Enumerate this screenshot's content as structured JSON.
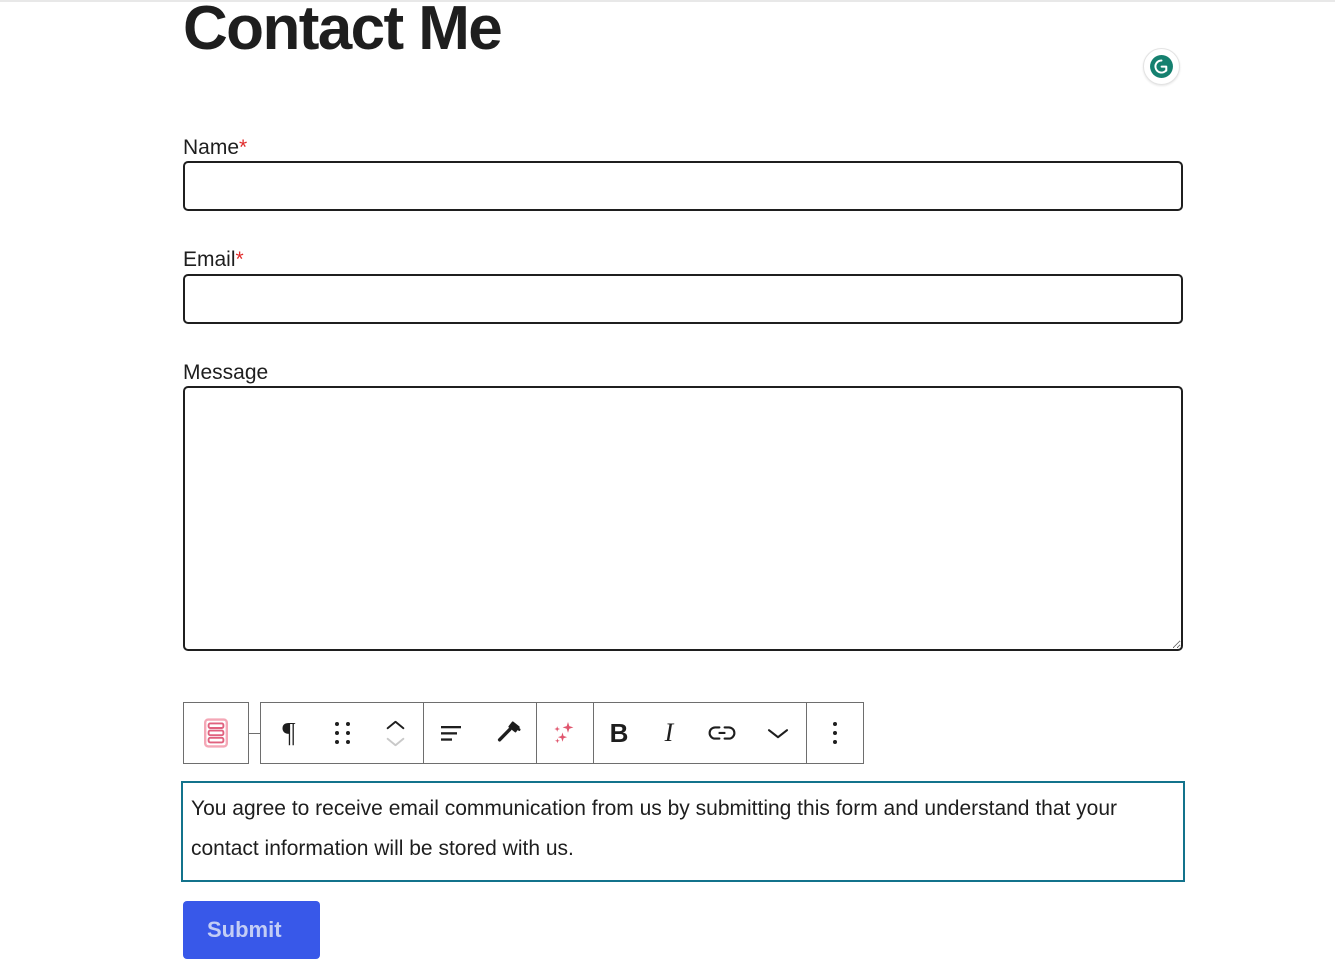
{
  "page": {
    "title": "Contact Me",
    "background": "#ffffff"
  },
  "browser_extension": {
    "name": "grammarly-badge",
    "letter": "G",
    "color": "#15806f"
  },
  "form": {
    "fields": [
      {
        "label": "Name",
        "required_marker": "*",
        "required": true,
        "value": "",
        "placeholder": "",
        "type": "text"
      },
      {
        "label": "Email",
        "required_marker": "*",
        "required": true,
        "value": "",
        "placeholder": "",
        "type": "email"
      },
      {
        "label": "Message",
        "required_marker": "",
        "required": false,
        "value": "",
        "placeholder": "",
        "type": "textarea"
      }
    ],
    "consent_text": "You agree to receive email communication from us by submitting this form and understand that your contact information will be stored with us.",
    "consent_border_color": "#13738c",
    "submit": {
      "label": "Submit",
      "background": "#3858e9",
      "text_color": "#c3cdf5"
    }
  },
  "block_toolbar": {
    "block_type_icon": "form-block-icon",
    "block_type_color": "#e8738f",
    "groups": [
      {
        "buttons": [
          {
            "name": "paragraph-icon",
            "glyph": "¶",
            "label": "Paragraph",
            "state": "enabled"
          },
          {
            "name": "drag-handle-icon",
            "glyph": "",
            "label": "Drag",
            "state": "enabled"
          },
          {
            "name": "move-up-down-icon",
            "glyph": "",
            "label": "Move up or down",
            "state": "partial"
          }
        ]
      },
      {
        "buttons": [
          {
            "name": "align-left-icon",
            "glyph": "",
            "label": "Align text",
            "state": "enabled"
          },
          {
            "name": "style-brush-icon",
            "glyph": "",
            "label": "Styles",
            "state": "enabled"
          }
        ]
      },
      {
        "buttons": [
          {
            "name": "ai-sparkles-icon",
            "glyph": "",
            "label": "AI assistant",
            "state": "enabled",
            "color": "#e0566e"
          }
        ]
      },
      {
        "buttons": [
          {
            "name": "bold-icon",
            "glyph": "B",
            "label": "Bold",
            "state": "enabled"
          },
          {
            "name": "italic-icon",
            "glyph": "I",
            "label": "Italic",
            "state": "enabled"
          },
          {
            "name": "link-icon",
            "glyph": "",
            "label": "Link",
            "state": "enabled"
          },
          {
            "name": "chevron-down-icon",
            "glyph": "",
            "label": "More rich text controls",
            "state": "enabled"
          }
        ]
      },
      {
        "buttons": [
          {
            "name": "more-options-icon",
            "glyph": "",
            "label": "Options",
            "state": "enabled"
          }
        ]
      }
    ]
  }
}
